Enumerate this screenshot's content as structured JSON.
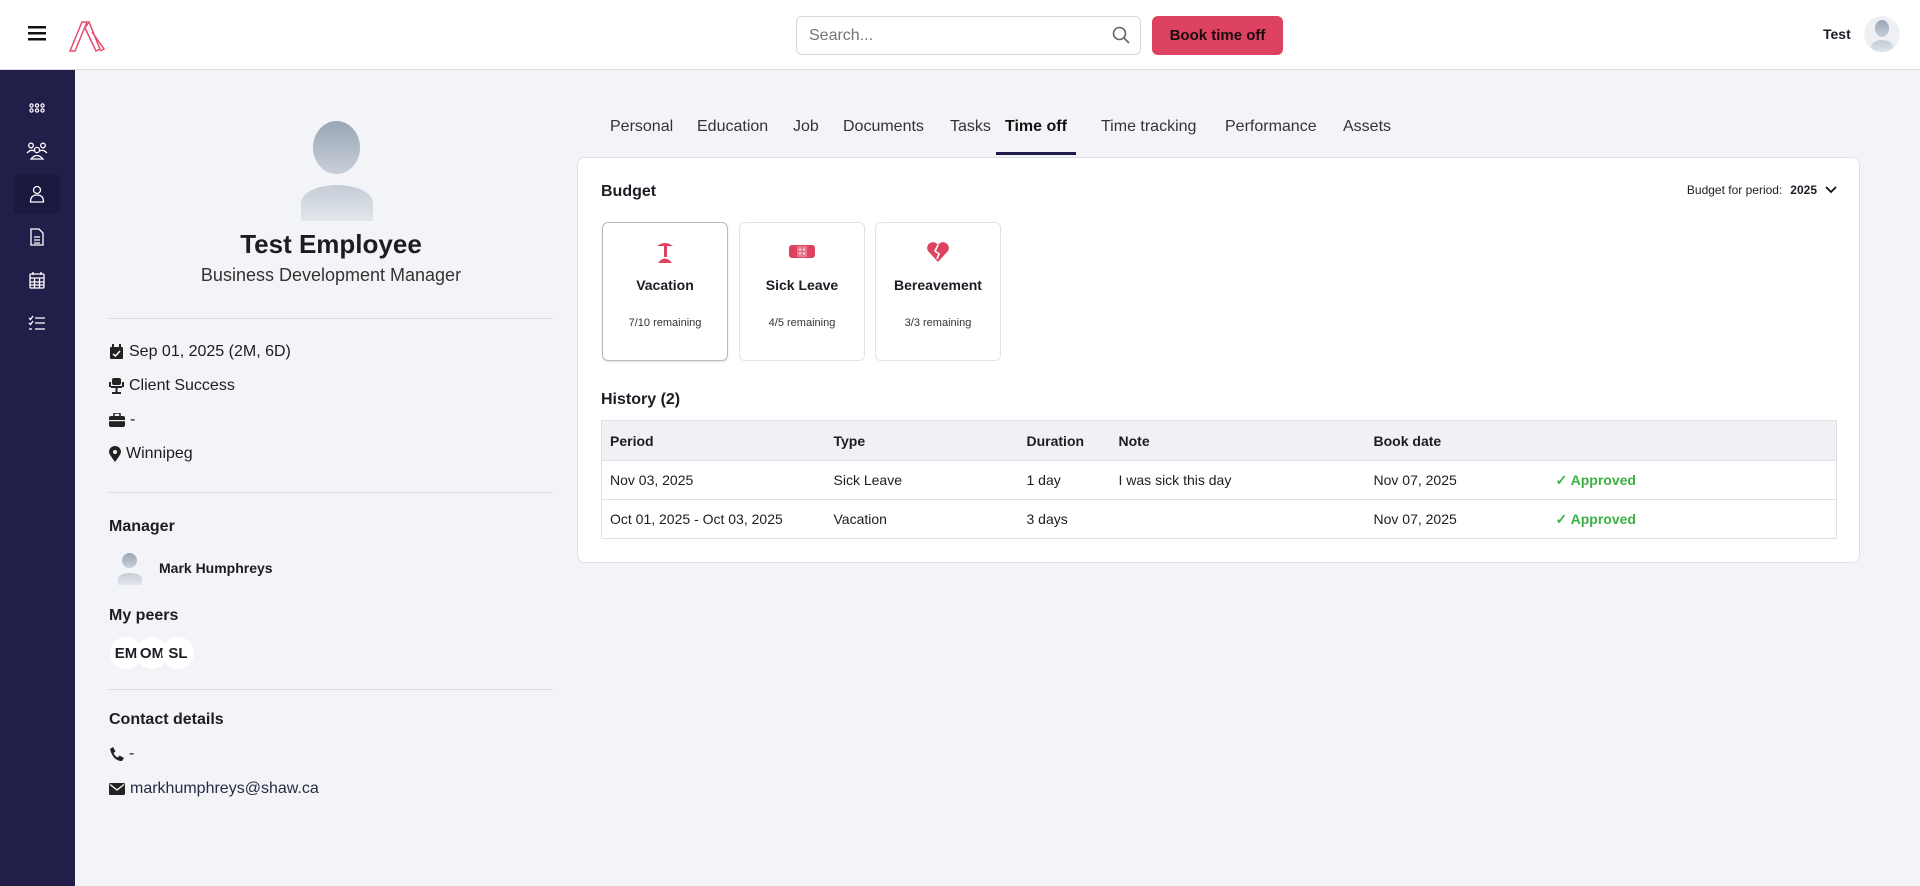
{
  "header": {
    "search_placeholder": "Search...",
    "book_button": "Book time off",
    "user_name": "Test"
  },
  "sidebar": {
    "items": [
      "apps",
      "people",
      "profile",
      "documents",
      "calendar",
      "tasks"
    ]
  },
  "profile": {
    "name": "Test Employee",
    "title": "Business Development Manager",
    "start_date": "Sep 01, 2025 (2M, 6D)",
    "department": "Client Success",
    "job": "-",
    "location": "Winnipeg",
    "manager_label": "Manager",
    "manager_name": "Mark Humphreys",
    "peers_label": "My peers",
    "peers": [
      "EM",
      "OM",
      "SL"
    ],
    "contact_label": "Contact details",
    "phone": "-",
    "email": "markhumphreys@shaw.ca"
  },
  "tabs": [
    "Personal",
    "Education",
    "Job",
    "Documents",
    "Tasks",
    "Time off",
    "Time tracking",
    "Performance",
    "Assets"
  ],
  "active_tab": "Time off",
  "budget": {
    "title": "Budget",
    "period_label": "Budget for period:",
    "period_value": "2025",
    "items": [
      {
        "name": "Vacation",
        "remaining": "7/10 remaining"
      },
      {
        "name": "Sick Leave",
        "remaining": "4/5 remaining"
      },
      {
        "name": "Bereavement",
        "remaining": "3/3 remaining"
      }
    ]
  },
  "history": {
    "title": "History (2)",
    "columns": [
      "Period",
      "Type",
      "Duration",
      "Note",
      "Book date",
      ""
    ],
    "rows": [
      [
        "Nov 03, 2025",
        "Sick Leave",
        "1 day",
        "I was sick this day",
        "Nov 07, 2025",
        "Approved"
      ],
      [
        "Oct 01, 2025 - Oct 03, 2025",
        "Vacation",
        "3 days",
        "",
        "Nov 07, 2025",
        "Approved"
      ]
    ]
  },
  "colors": {
    "accent": "#dd4360",
    "sidebar": "#221e4a",
    "approved": "#3cb043"
  }
}
